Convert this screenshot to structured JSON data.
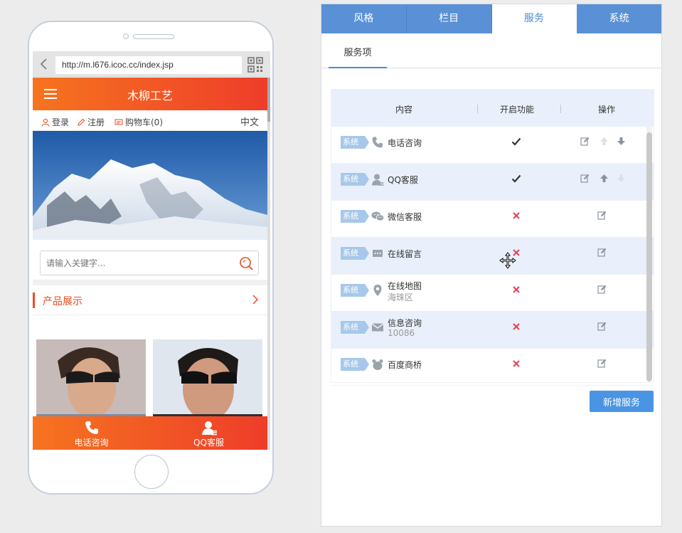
{
  "browser": {
    "url": "http://m.l676.icoc.cc/index.jsp"
  },
  "site": {
    "title": "木柳工艺",
    "user_bar": {
      "login": "登录",
      "register": "注册",
      "cart": "购物车(0)",
      "language": "中文"
    },
    "search": {
      "placeholder": "请输入关键字..."
    },
    "section_title": "产品展示",
    "bottom_nav": [
      {
        "label": "电话咨询",
        "icon": "phone-icon"
      },
      {
        "label": "QQ客服",
        "icon": "qq-service-icon"
      }
    ]
  },
  "panel": {
    "tabs": [
      "风格",
      "栏目",
      "服务",
      "系统"
    ],
    "active_tab": "服务",
    "subtab": "服务项",
    "table": {
      "headers": {
        "content": "内容",
        "enabled": "开启功能",
        "actions": "操作"
      },
      "rows": [
        {
          "tag": "系统",
          "icon": "phone-icon",
          "name": "电话咨询",
          "sub": "",
          "enabled": true,
          "up_enabled": false,
          "down_enabled": true,
          "show_order": true
        },
        {
          "tag": "系统",
          "icon": "qq-service-icon",
          "name": "QQ客服",
          "sub": "",
          "enabled": true,
          "up_enabled": true,
          "down_enabled": false,
          "show_order": true
        },
        {
          "tag": "系统",
          "icon": "wechat-icon",
          "name": "微信客服",
          "sub": "",
          "enabled": false,
          "show_order": false
        },
        {
          "tag": "系统",
          "icon": "chat-bubble-icon",
          "name": "在线留言",
          "sub": "",
          "enabled": false,
          "show_order": false
        },
        {
          "tag": "系统",
          "icon": "map-pin-icon",
          "name": "在线地图",
          "sub": "海珠区",
          "enabled": false,
          "show_order": false
        },
        {
          "tag": "系统",
          "icon": "envelope-icon",
          "name": "信息咨询",
          "sub": "10086",
          "enabled": false,
          "show_order": false
        },
        {
          "tag": "系统",
          "icon": "baidu-bear-icon",
          "name": "百度商桥",
          "sub": "",
          "enabled": false,
          "show_order": false
        }
      ]
    },
    "add_button": "新增服务"
  },
  "colors": {
    "accent_blue": "#4a8ad9",
    "tab_blue": "#5a91d6",
    "brand_orange": "#f6741f",
    "brand_red": "#ee3d2a",
    "disabled_red": "#e0475a"
  }
}
